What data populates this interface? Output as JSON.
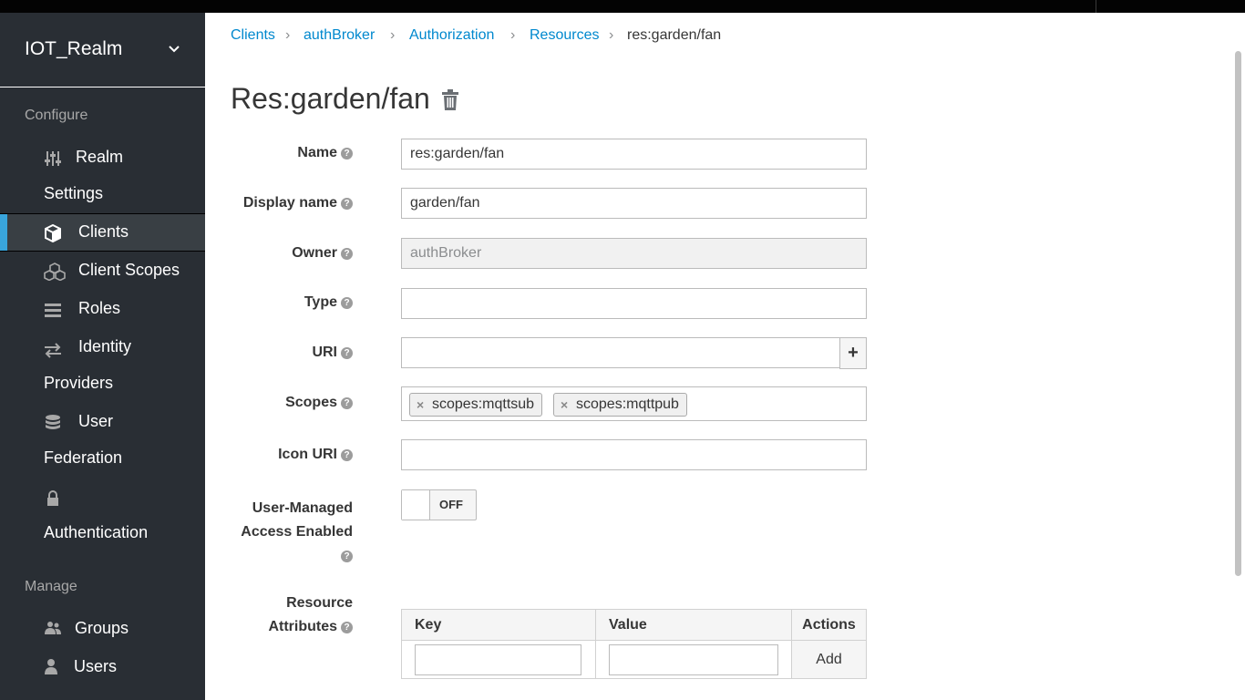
{
  "realm": {
    "name": "IOT_Realm"
  },
  "sidebar": {
    "configure_heading": "Configure",
    "manage_heading": "Manage",
    "configure_items": [
      {
        "label_line1": "Realm",
        "label_line2": "Settings",
        "icon": "sliders-icon"
      },
      {
        "label_line1": "Clients",
        "icon": "cube-icon",
        "active": true
      },
      {
        "label_line1": "Client Scopes",
        "icon": "cubes-icon"
      },
      {
        "label_line1": "Roles",
        "icon": "list-icon"
      },
      {
        "label_line1": "Identity",
        "label_line2": "Providers",
        "icon": "exchange-icon"
      },
      {
        "label_line1": "User",
        "label_line2": "Federation",
        "icon": "database-icon"
      },
      {
        "label_line1": "Authentication",
        "icon": "lock-icon"
      }
    ],
    "manage_items": [
      {
        "label_line1": "Groups",
        "icon": "users-icon"
      },
      {
        "label_line1": "Users",
        "icon": "user-icon"
      }
    ]
  },
  "breadcrumb": {
    "items": [
      "Clients",
      "authBroker",
      "Authorization",
      "Resources",
      "res:garden/fan"
    ],
    "separator": "›"
  },
  "page": {
    "title": "Res:garden/fan"
  },
  "form": {
    "name": {
      "label": "Name",
      "value": "res:garden/fan"
    },
    "display_name": {
      "label": "Display name",
      "value": "garden/fan"
    },
    "owner": {
      "label": "Owner",
      "value": "authBroker"
    },
    "type": {
      "label": "Type",
      "value": ""
    },
    "uri": {
      "label": "URI",
      "value": "",
      "add": "+"
    },
    "scopes": {
      "label": "Scopes",
      "values": [
        "scopes:mqttsub",
        "scopes:mqttpub"
      ],
      "remove": "×"
    },
    "icon_uri": {
      "label": "Icon URI",
      "value": ""
    },
    "uma": {
      "label_line1": "User-Managed",
      "label_line2": "Access Enabled",
      "state": "OFF"
    },
    "attributes": {
      "label_line1": "Resource",
      "label_line2": "Attributes",
      "headers": [
        "Key",
        "Value",
        "Actions"
      ],
      "add_label": "Add"
    },
    "help": "?"
  },
  "colors": {
    "sidebar_bg": "#292e34",
    "accent": "#39a5dc",
    "link": "#0088ce"
  }
}
